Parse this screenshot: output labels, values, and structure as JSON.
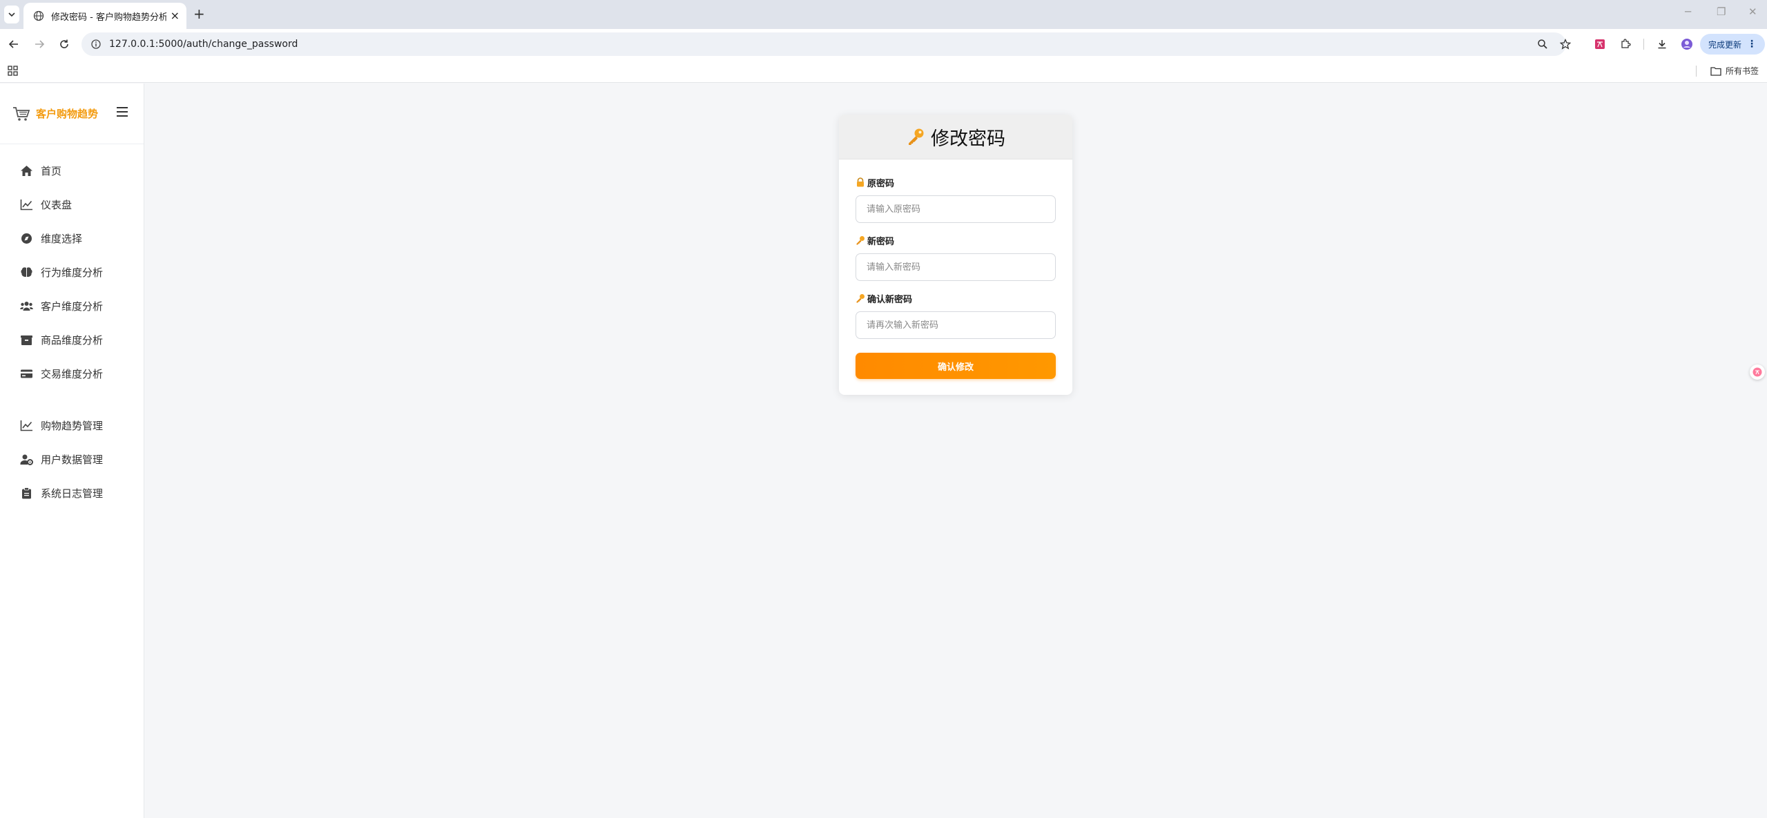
{
  "browser": {
    "tab_title": "修改密码 - 客户购物趋势分析系统",
    "url": "127.0.0.1:5000/auth/change_password",
    "update_label": "完成更新",
    "bookmarks_label": "所有书签"
  },
  "sidebar": {
    "brand": "客户购物趋势",
    "items": [
      {
        "label": "首页",
        "icon": "home-icon"
      },
      {
        "label": "仪表盘",
        "icon": "chart-line-icon"
      },
      {
        "label": "维度选择",
        "icon": "compass-icon"
      },
      {
        "label": "行为维度分析",
        "icon": "brain-icon"
      },
      {
        "label": "客户维度分析",
        "icon": "users-icon"
      },
      {
        "label": "商品维度分析",
        "icon": "box-icon"
      },
      {
        "label": "交易维度分析",
        "icon": "credit-card-icon"
      }
    ],
    "admin_items": [
      {
        "label": "购物趋势管理",
        "icon": "chart-line-icon"
      },
      {
        "label": "用户数据管理",
        "icon": "user-gear-icon"
      },
      {
        "label": "系统日志管理",
        "icon": "clipboard-icon"
      }
    ]
  },
  "form": {
    "title": "修改密码",
    "old_password": {
      "label": "原密码",
      "placeholder": "请输入原密码"
    },
    "new_password": {
      "label": "新密码",
      "placeholder": "请输入新密码"
    },
    "confirm_password": {
      "label": "确认新密码",
      "placeholder": "请再次输入新密码"
    },
    "submit_label": "确认修改"
  },
  "colors": {
    "accent": "#ff9800",
    "brand": "#f39c12"
  }
}
